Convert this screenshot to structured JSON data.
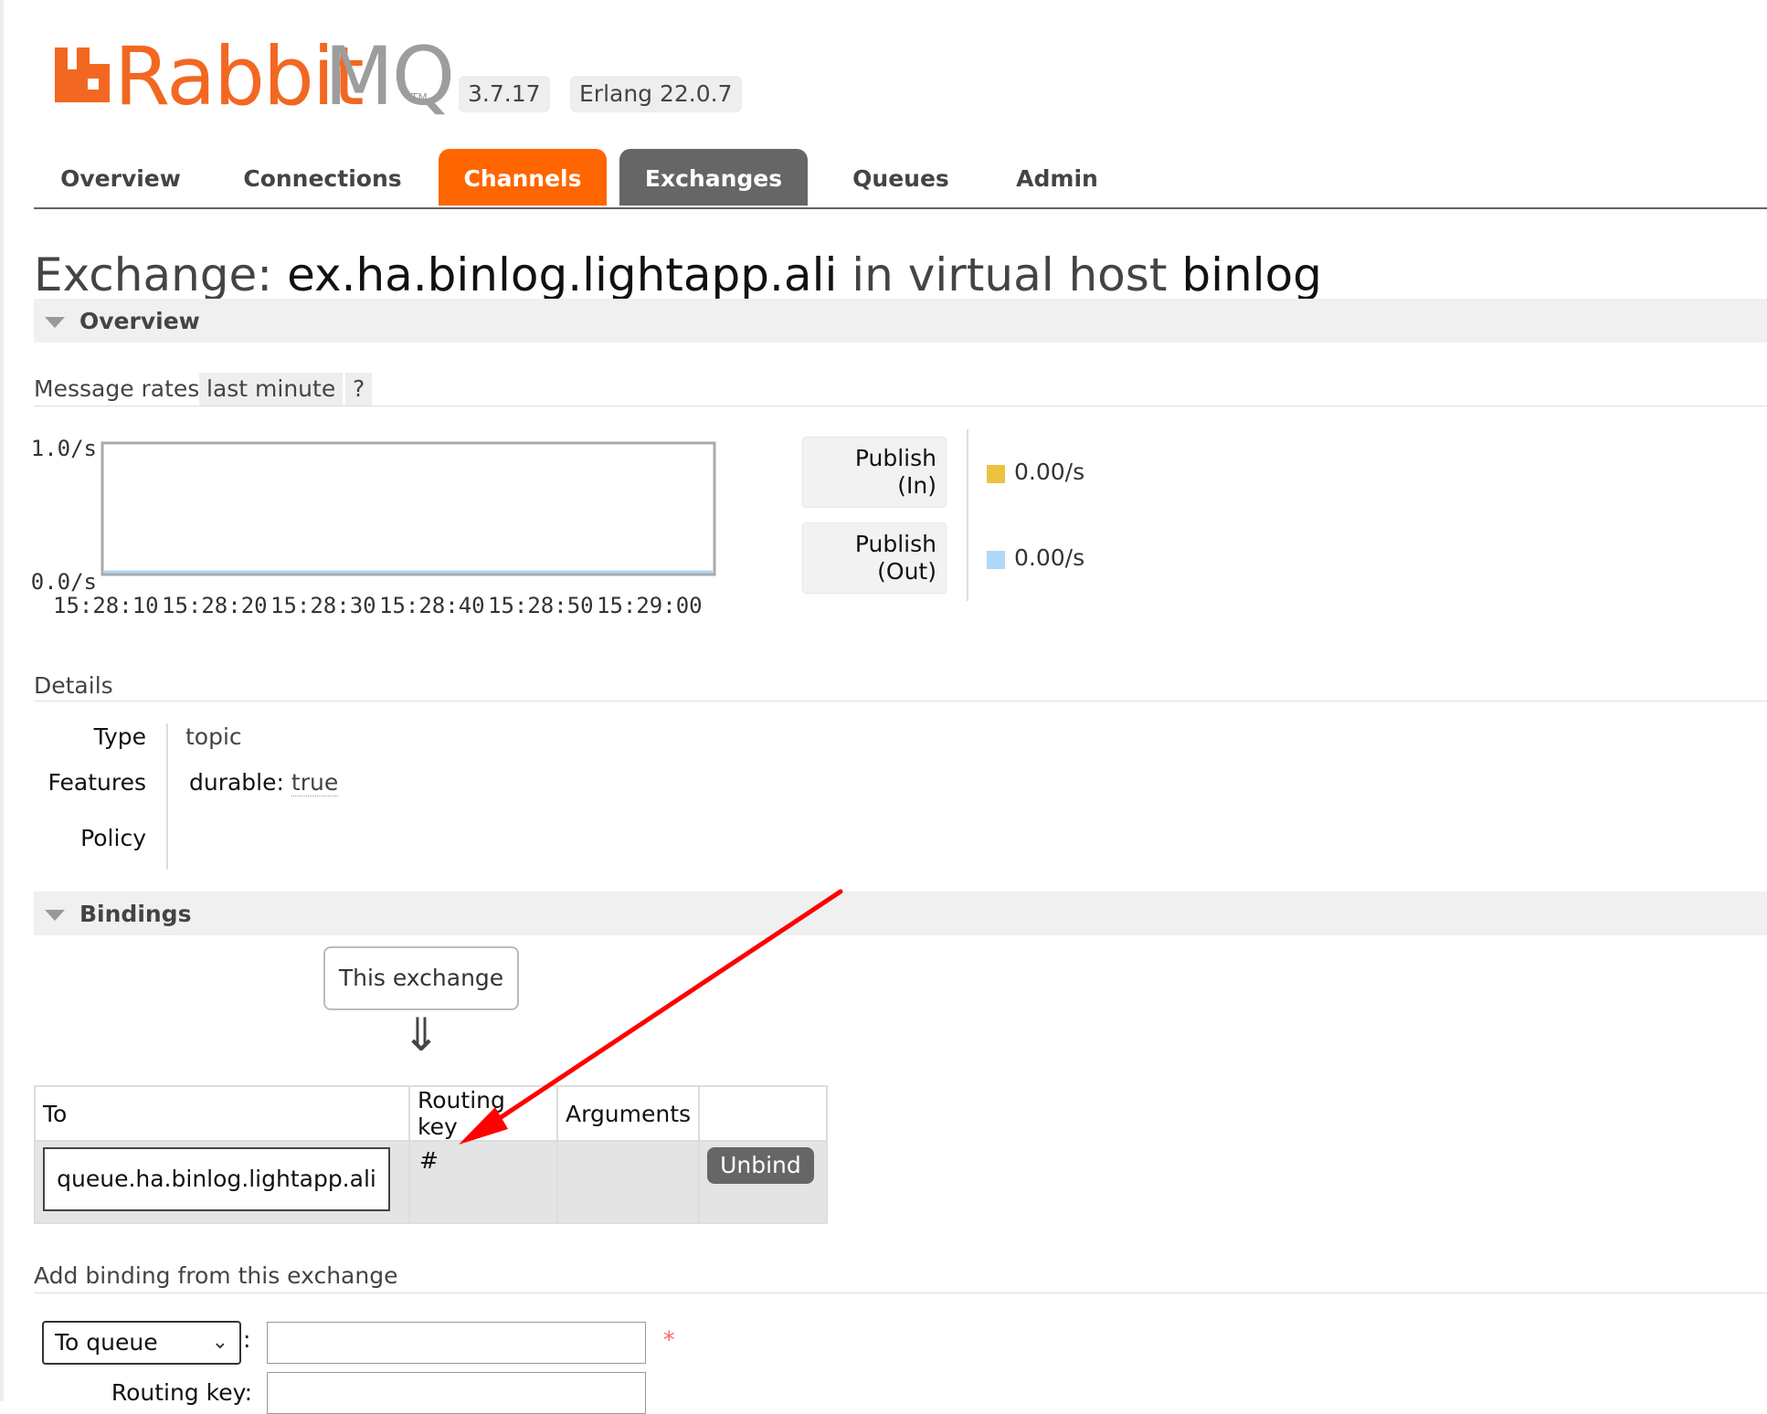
{
  "app": {
    "logo_rabbit": "Rabbit",
    "logo_mq": "MQ",
    "logo_tm": "TM",
    "version": "3.7.17",
    "erlang": "Erlang 22.0.7",
    "brand_color": "#f26822"
  },
  "nav": {
    "tabs": [
      {
        "label": "Overview",
        "state": "normal"
      },
      {
        "label": "Connections",
        "state": "normal"
      },
      {
        "label": "Channels",
        "state": "highlighted"
      },
      {
        "label": "Exchanges",
        "state": "selected"
      },
      {
        "label": "Queues",
        "state": "normal"
      },
      {
        "label": "Admin",
        "state": "normal"
      }
    ]
  },
  "page": {
    "title_prefix": "Exchange:",
    "exchange_name": "ex.ha.binlog.lightapp.ali",
    "title_mid": "in virtual host",
    "vhost": "binlog"
  },
  "overview": {
    "section_label": "Overview",
    "message_rates_label": "Message rates",
    "range_label": "last minute",
    "help_label": "?",
    "rates": [
      {
        "label_line1": "Publish",
        "label_line2": "(In)",
        "value": "0.00/s",
        "color": "#edc240"
      },
      {
        "label_line1": "Publish",
        "label_line2": "(Out)",
        "value": "0.00/s",
        "color": "#afd8f8"
      }
    ]
  },
  "chart_data": {
    "type": "line",
    "title": "",
    "xlabel": "",
    "ylabel": "",
    "x": [
      "15:28:10",
      "15:28:20",
      "15:28:30",
      "15:28:40",
      "15:28:50",
      "15:29:00"
    ],
    "y_tick_labels": [
      "1.0/s",
      "0.0/s"
    ],
    "ylim": [
      0,
      1.0
    ],
    "series": [
      {
        "name": "Publish (In)",
        "values": [
          0,
          0,
          0,
          0,
          0,
          0
        ],
        "color": "#edc240"
      },
      {
        "name": "Publish (Out)",
        "values": [
          0,
          0,
          0,
          0,
          0,
          0
        ],
        "color": "#afd8f8"
      }
    ]
  },
  "details": {
    "section_label": "Details",
    "type_label": "Type",
    "type_value": "topic",
    "features_label": "Features",
    "feature_key": "durable:",
    "feature_value": "true",
    "policy_label": "Policy",
    "policy_value": ""
  },
  "bindings": {
    "section_label": "Bindings",
    "this_exchange": "This exchange",
    "arrow_glyph": "⇓",
    "columns": [
      "To",
      "Routing key",
      "Arguments",
      ""
    ],
    "rows": [
      {
        "to": "queue.ha.binlog.lightapp.ali",
        "routing_key": "#",
        "arguments": "",
        "action": "Unbind"
      }
    ]
  },
  "add_binding": {
    "heading": "Add binding from this exchange",
    "destination_select": "To queue",
    "colon": ":",
    "required_mark": "*",
    "routing_key_label": "Routing key:"
  },
  "annotation": {
    "arrow_color": "#ff0000"
  }
}
